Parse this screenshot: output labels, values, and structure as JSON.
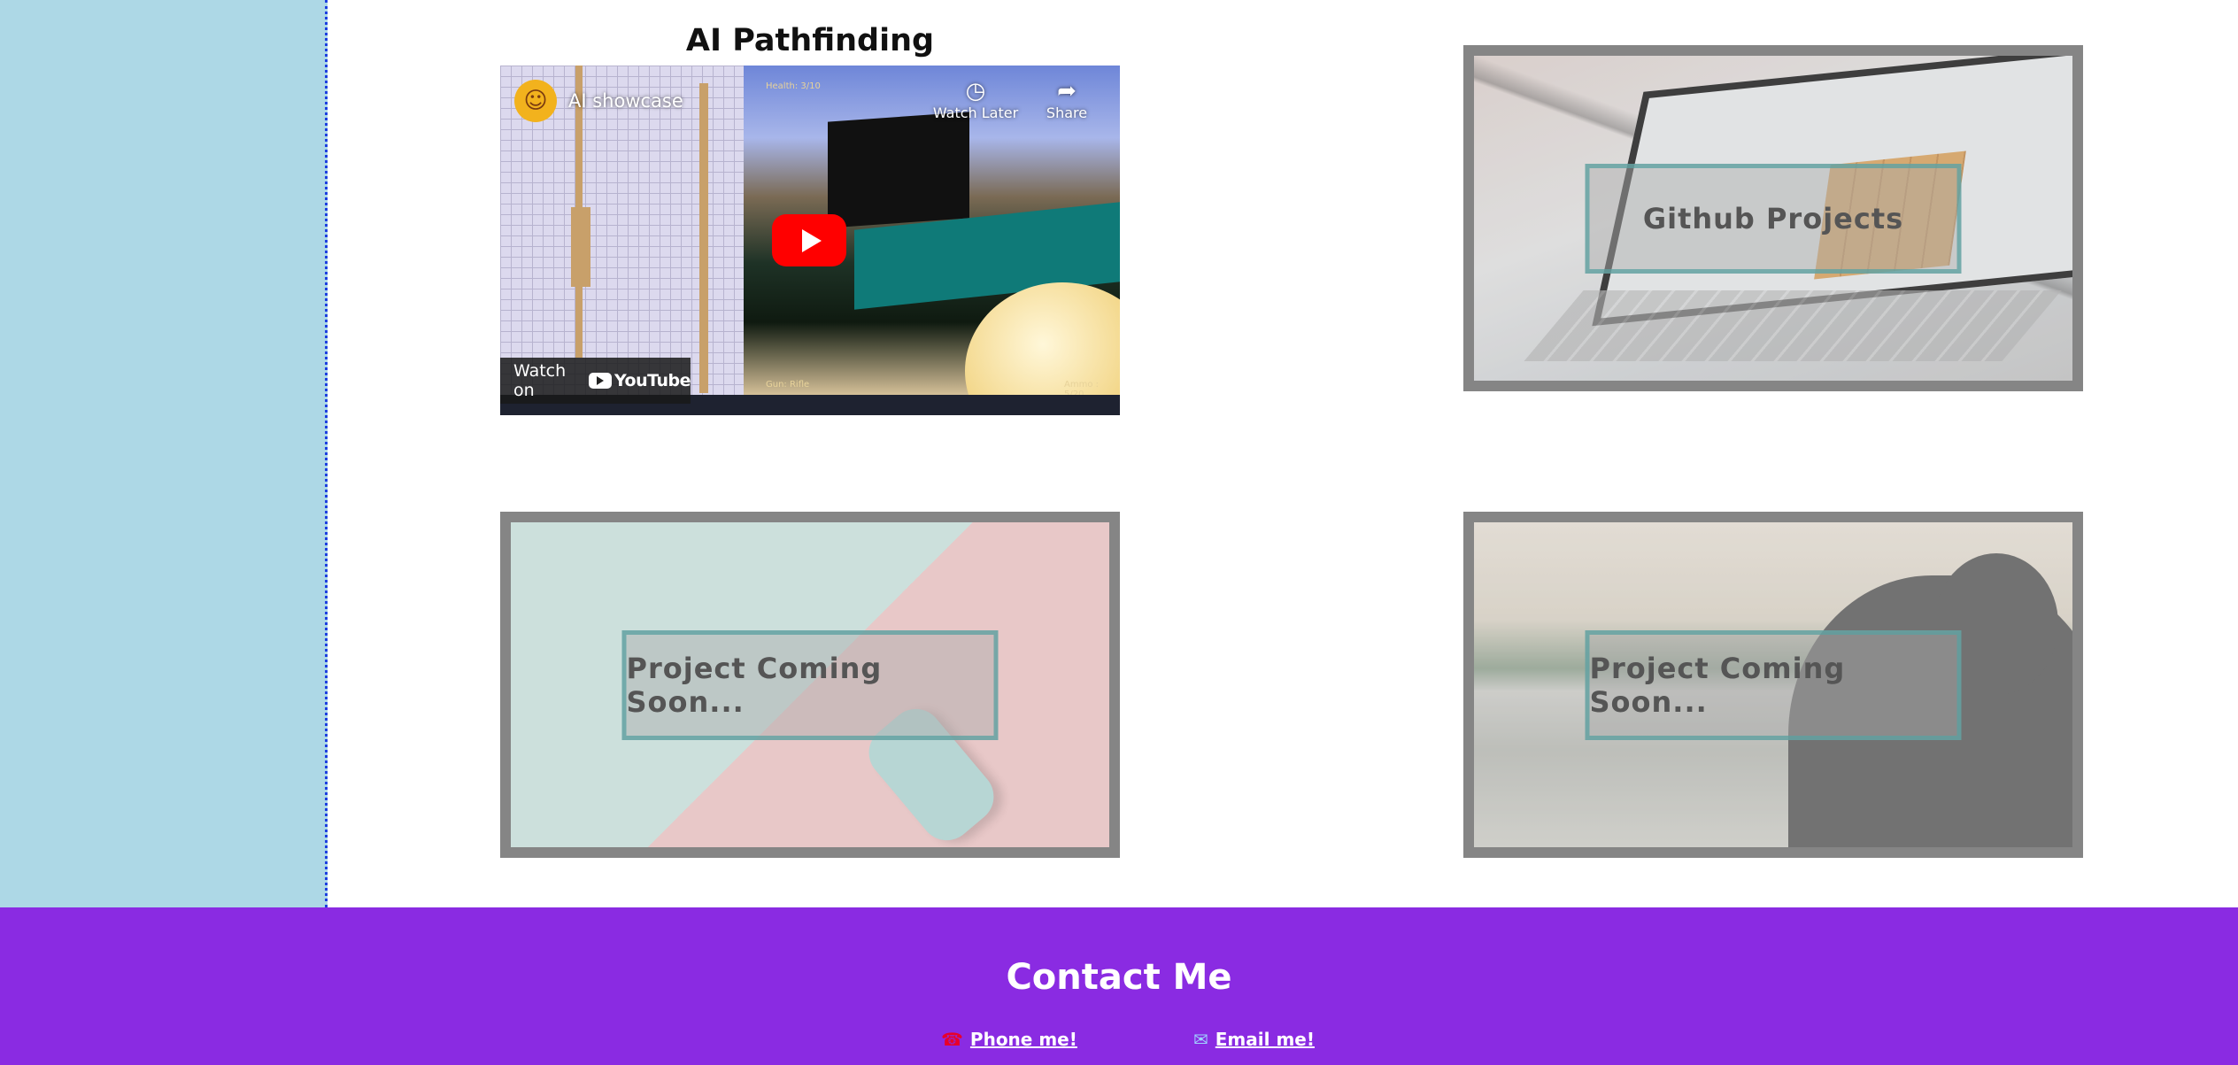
{
  "projects": {
    "video_project": {
      "title": "AI Pathfinding",
      "video": {
        "title": "AI showcase",
        "watch_later_label": "Watch Later",
        "share_label": "Share",
        "watch_on_label": "Watch on",
        "youtube_label": "YouTube",
        "hud_health": "Health: 3/10",
        "hud_gun": "Gun: Rifle",
        "hud_ammo": "Ammo : 5/20"
      }
    },
    "github": {
      "label": "Github Projects"
    },
    "coming_soon_1": {
      "label": "Project Coming Soon..."
    },
    "coming_soon_2": {
      "label": "Project Coming Soon..."
    }
  },
  "footer": {
    "heading": "Contact Me",
    "phone_label": "Phone me!",
    "email_label": "Email me!",
    "phone_icon": "phone-icon",
    "email_icon": "email-icon"
  },
  "colors": {
    "sidebar": "#add8e6",
    "footer": "#8a2be2",
    "card_border": "#858585",
    "youtube_red": "#ff0000"
  }
}
